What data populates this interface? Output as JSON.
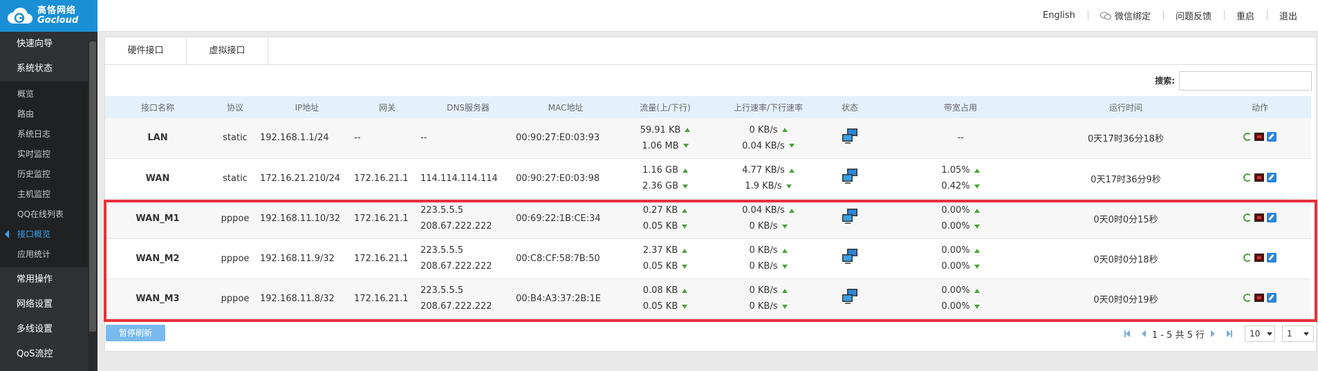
{
  "brand": {
    "cn": "高恪网络",
    "en": "Gocloud",
    "color": "#1a8fd6"
  },
  "header": {
    "links": [
      "English",
      "微信绑定",
      "问题反馈",
      "重启",
      "退出"
    ]
  },
  "sidebar": {
    "top_items": [
      "快速向导",
      "系统状态"
    ],
    "sub_items": [
      "概览",
      "路由",
      "系统日志",
      "实时监控",
      "历史监控",
      "主机监控",
      "QQ在线列表",
      "接口概览",
      "应用统计"
    ],
    "active_sub": "接口概览",
    "bottom_items": [
      "常用操作",
      "网络设置",
      "多线设置",
      "QoS流控"
    ]
  },
  "tabs": [
    "硬件接口",
    "虚拟接口"
  ],
  "search": {
    "label": "搜索:",
    "value": ""
  },
  "table": {
    "headers": [
      "接口名称",
      "协议",
      "IP地址",
      "网关",
      "DNS服务器",
      "MAC地址",
      "流量(上/下行)",
      "上行速率/下行速率",
      "状态",
      "带宽占用",
      "运行时间",
      "动作"
    ],
    "rows": [
      {
        "name": "LAN",
        "proto": "static",
        "ip": "192.168.1.1/24",
        "gw": "--",
        "dns": [
          "--"
        ],
        "mac": "00:90:27:E0:03:93",
        "traffic": [
          "59.91 KB",
          "1.06 MB"
        ],
        "rate": [
          "0 KB/s",
          "0.04 KB/s"
        ],
        "bw": [
          "--"
        ],
        "uptime": "0天17时36分18秒"
      },
      {
        "name": "WAN",
        "proto": "static",
        "ip": "172.16.21.210/24",
        "gw": "172.16.21.1",
        "dns": [
          "114.114.114.114"
        ],
        "mac": "00:90:27:E0:03:98",
        "traffic": [
          "1.16 GB",
          "2.36 GB"
        ],
        "rate": [
          "4.77 KB/s",
          "1.9 KB/s"
        ],
        "bw": [
          "1.05%",
          "0.42%"
        ],
        "uptime": "0天17时36分9秒"
      },
      {
        "name": "WAN_M1",
        "proto": "pppoe",
        "ip": "192.168.11.10/32",
        "gw": "172.16.21.1",
        "dns": [
          "223.5.5.5",
          "208.67.222.222"
        ],
        "mac": "00:69:22:1B:CE:34",
        "traffic": [
          "0.27 KB",
          "0.05 KB"
        ],
        "rate": [
          "0.04 KB/s",
          "0 KB/s"
        ],
        "bw": [
          "0.00%",
          "0.00%"
        ],
        "uptime": "0天0时0分15秒"
      },
      {
        "name": "WAN_M2",
        "proto": "pppoe",
        "ip": "192.168.11.9/32",
        "gw": "172.16.21.1",
        "dns": [
          "223.5.5.5",
          "208.67.222.222"
        ],
        "mac": "00:C8:CF:58:7B:50",
        "traffic": [
          "2.37 KB",
          "0.05 KB"
        ],
        "rate": [
          "0 KB/s",
          "0 KB/s"
        ],
        "bw": [
          "0.00%",
          "0.00%"
        ],
        "uptime": "0天0时0分18秒"
      },
      {
        "name": "WAN_M3",
        "proto": "pppoe",
        "ip": "192.168.11.8/32",
        "gw": "172.16.21.1",
        "dns": [
          "223.5.5.5",
          "208.67.222.222"
        ],
        "mac": "00:B4:A3:37:2B:1E",
        "traffic": [
          "0.08 KB",
          "0.05 KB"
        ],
        "rate": [
          "0 KB/s",
          "0 KB/s"
        ],
        "bw": [
          "0.00%",
          "0.00%"
        ],
        "uptime": "0天0时0分19秒"
      }
    ]
  },
  "footer": {
    "pause_label": "暂停刷新",
    "pager_text": "1 - 5 共 5 行",
    "page_size": "10",
    "page": "1"
  },
  "icons": {
    "status": "network-computer-icon",
    "actions": [
      "refresh-icon",
      "network-card-icon",
      "edit-icon"
    ]
  },
  "highlight_color": "#e8303a"
}
